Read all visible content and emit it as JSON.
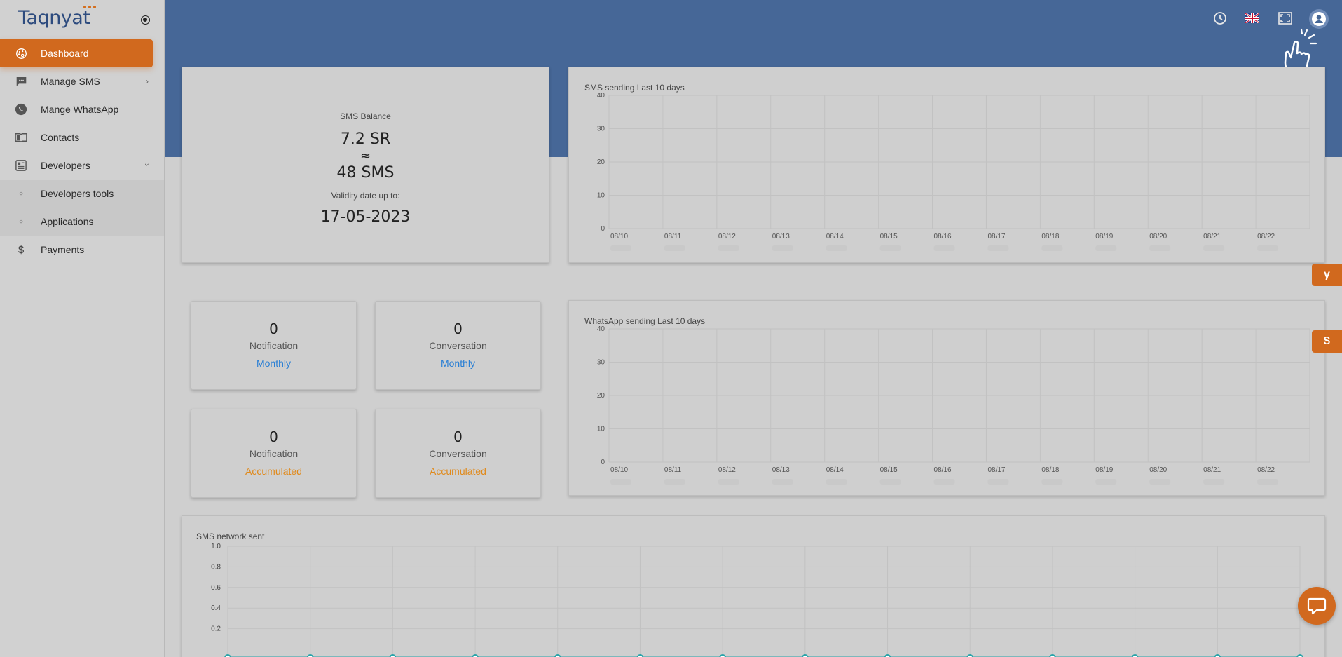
{
  "brand": {
    "name": "Taqnyat"
  },
  "sidebar": {
    "items": [
      {
        "label": "Dashboard",
        "icon": "palette-icon"
      },
      {
        "label": "Manage SMS",
        "icon": "sms-icon"
      },
      {
        "label": "Mange WhatsApp",
        "icon": "whatsapp-icon"
      },
      {
        "label": "Contacts",
        "icon": "contacts-book-icon"
      },
      {
        "label": "Developers",
        "icon": "developers-icon"
      },
      {
        "label": "Developers tools",
        "icon": "circle-bullet-icon"
      },
      {
        "label": "Applications",
        "icon": "circle-bullet-icon"
      },
      {
        "label": "Payments",
        "icon": "dollar-icon"
      }
    ]
  },
  "header": {
    "icons": [
      "history-icon",
      "uk-flag-icon",
      "fullscreen-icon",
      "user-account-icon"
    ],
    "color": "#466797"
  },
  "balance": {
    "title": "SMS Balance",
    "amount": "7.2 SR",
    "approx": "≈",
    "sms": "48 SMS",
    "validity_label": "Validity date up to:",
    "validity_date": "17-05-2023"
  },
  "stats": [
    {
      "value": "0",
      "kind": "Notification",
      "period": "Monthly",
      "color": "#2a7fd4"
    },
    {
      "value": "0",
      "kind": "Conversation",
      "period": "Monthly",
      "color": "#2a7fd4"
    },
    {
      "value": "0",
      "kind": "Notification",
      "period": "Accumulated",
      "color": "#e08a1c"
    },
    {
      "value": "0",
      "kind": "Conversation",
      "period": "Accumulated",
      "color": "#e08a1c"
    }
  ],
  "side_tabs": [
    "γ",
    "$"
  ],
  "chart_data": [
    {
      "type": "bar",
      "title": "SMS sending Last 10 days",
      "categories": [
        "08/10",
        "08/11",
        "08/12",
        "08/13",
        "08/14",
        "08/15",
        "08/16",
        "08/17",
        "08/18",
        "08/19",
        "08/20",
        "08/21",
        "08/22"
      ],
      "values": [
        0,
        0,
        0,
        0,
        0,
        0,
        0,
        0,
        0,
        0,
        0,
        0,
        0
      ],
      "y_ticks": [
        "0",
        "10",
        "20",
        "30",
        "40"
      ],
      "ylim": [
        0,
        40
      ]
    },
    {
      "type": "bar",
      "title": "WhatsApp sending Last 10 days",
      "categories": [
        "08/10",
        "08/11",
        "08/12",
        "08/13",
        "08/14",
        "08/15",
        "08/16",
        "08/17",
        "08/18",
        "08/19",
        "08/20",
        "08/21",
        "08/22"
      ],
      "values": [
        0,
        0,
        0,
        0,
        0,
        0,
        0,
        0,
        0,
        0,
        0,
        0,
        0
      ],
      "y_ticks": [
        "0",
        "10",
        "20",
        "30",
        "40"
      ],
      "ylim": [
        0,
        40
      ]
    },
    {
      "type": "line",
      "title": "SMS network sent",
      "x_count": 14,
      "values": [
        0,
        0,
        0,
        0,
        0,
        0,
        0,
        0,
        0,
        0,
        0,
        0,
        0,
        0
      ],
      "y_ticks": [
        "0.2",
        "0.4",
        "0.6",
        "0.8",
        "1.0"
      ],
      "ylim": [
        0,
        1
      ],
      "color": "#2aa3a8"
    }
  ]
}
